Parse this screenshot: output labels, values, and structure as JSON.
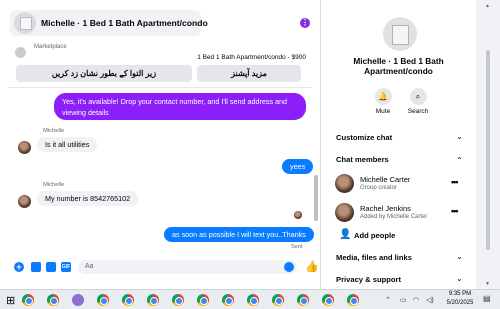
{
  "chat": {
    "title": "Michelle · 1 Bed 1 Bath Apartment/condo",
    "marketplace_label": "Marketplace",
    "listing_title": "1 Bed 1 Bath Apartment/condo - $900",
    "quick_actions": [
      "زیر التوا کے بطور نشان زد کریں",
      "مزید آپشنز"
    ],
    "messages": [
      {
        "from": "me",
        "text": "Yes, it's available! Drop your contact number, and I'll send address and viewing details"
      },
      {
        "from": "Michelle",
        "text": "Is it all utilities"
      },
      {
        "from": "me",
        "text": "yees"
      },
      {
        "from": "Michelle",
        "text": "My number is 8542765102"
      },
      {
        "from": "me",
        "text": "as soon as possible I will text you..Thanks"
      }
    ],
    "sender_names": [
      "Michelle",
      "Michelle"
    ],
    "sent_status": "Sent",
    "composer_placeholder": "Aa",
    "accent_purple": "#8b1ef9",
    "accent_blue": "#0a7cff"
  },
  "panel": {
    "title": "Michelle · 1 Bed 1 Bath Apartment/condo",
    "actions": [
      {
        "label": "Mute",
        "icon": "bell-icon"
      },
      {
        "label": "Search",
        "icon": "search-icon"
      }
    ],
    "sections": {
      "customize": "Customize chat",
      "members": "Chat members",
      "media": "Media, files and links",
      "privacy": "Privacy & support"
    },
    "members": [
      {
        "name": "Michelle Carter",
        "role": "Group creator"
      },
      {
        "name": "Rachel Jenkins",
        "role": "Added by Michelle Carter"
      }
    ],
    "add_people": "Add people"
  },
  "taskbar": {
    "time": "9:35 PM",
    "date": "5/20/2025"
  }
}
